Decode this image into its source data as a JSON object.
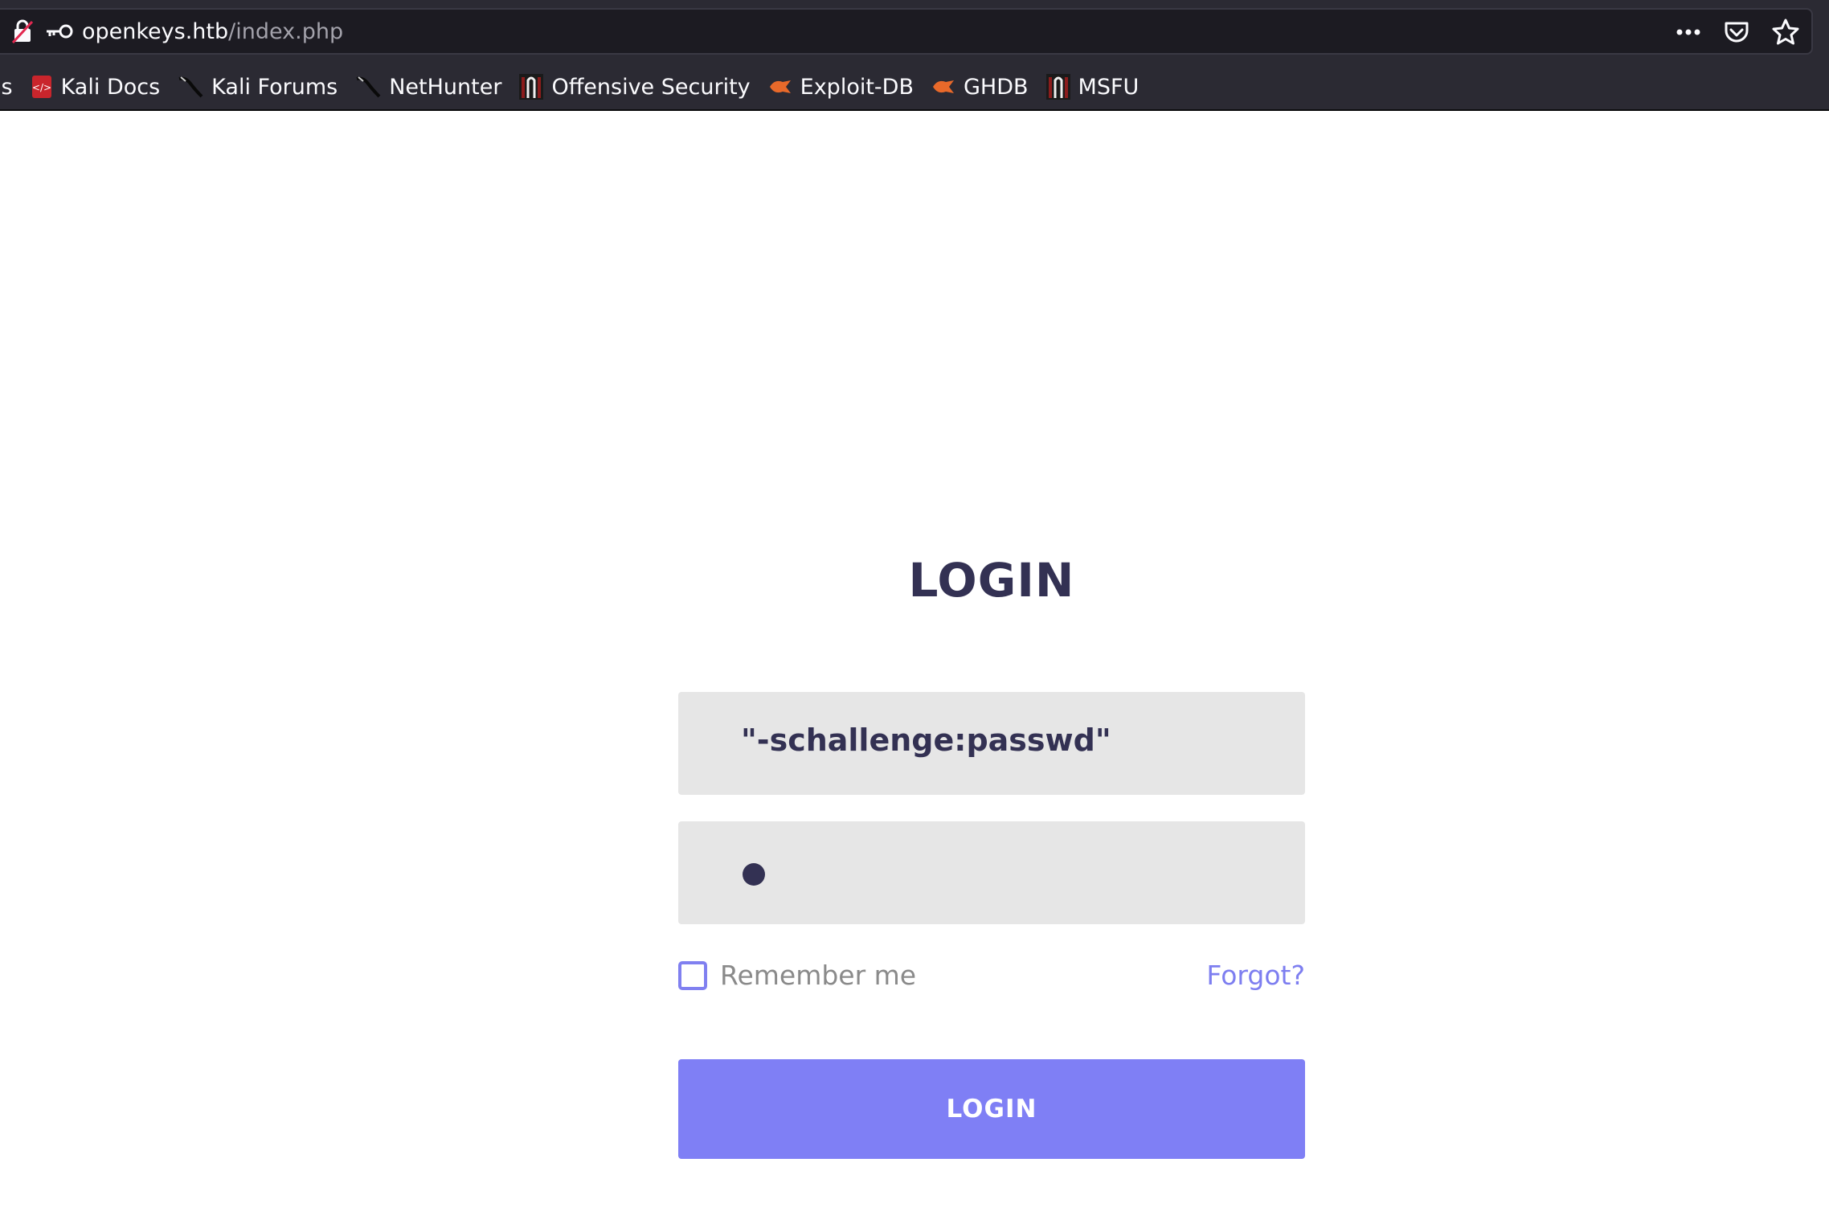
{
  "browser": {
    "url_host": "openkeys.htb",
    "url_path": "/index.php",
    "bookmarks": [
      {
        "label": "ls",
        "icon": "truncated"
      },
      {
        "label": "Kali Docs",
        "icon": "kali-docs-icon"
      },
      {
        "label": "Kali Forums",
        "icon": "kali-dragon-icon"
      },
      {
        "label": "NetHunter",
        "icon": "kali-dragon-icon"
      },
      {
        "label": "Offensive Security",
        "icon": "offsec-icon"
      },
      {
        "label": "Exploit-DB",
        "icon": "exploitdb-icon"
      },
      {
        "label": "GHDB",
        "icon": "exploitdb-icon"
      },
      {
        "label": "MSFU",
        "icon": "offsec-icon"
      }
    ]
  },
  "login": {
    "title": "LOGIN",
    "username_value": "\"-schallenge:passwd\"",
    "remember_label": "Remember me",
    "forgot_label": "Forgot?",
    "button_label": "LOGIN"
  },
  "colors": {
    "accent": "#7f7ff5",
    "title": "#333153",
    "field_bg": "#e6e6e6"
  }
}
